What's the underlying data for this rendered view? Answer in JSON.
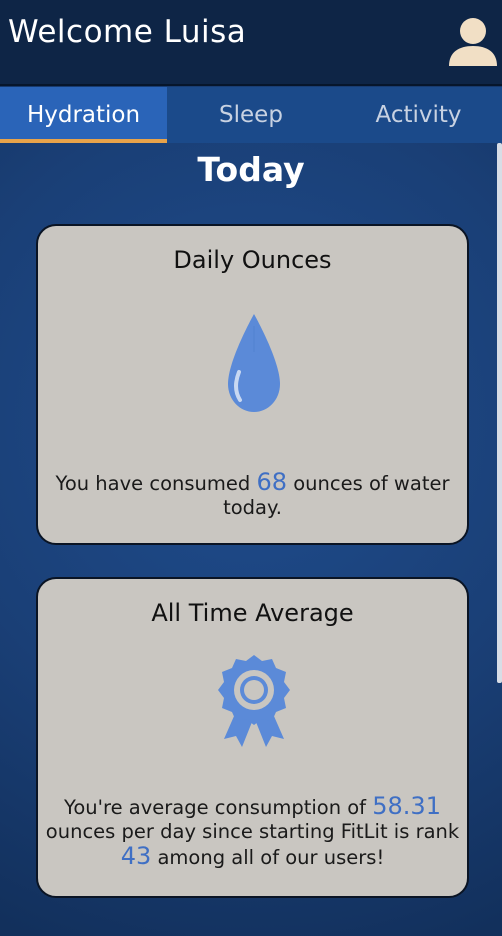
{
  "header": {
    "welcome": "Welcome Luisa"
  },
  "tabs": [
    {
      "label": "Hydration",
      "active": true
    },
    {
      "label": "Sleep",
      "active": false
    },
    {
      "label": "Activity",
      "active": false
    }
  ],
  "section_title": "Today",
  "daily_card": {
    "title": "Daily Ounces",
    "text_before": "You have consumed",
    "ounces": "68",
    "text_after": "ounces of water today.",
    "icon": "water-drop-icon"
  },
  "average_card": {
    "title": "All Time Average",
    "text_before": "You're average consumption of",
    "average": "58.31",
    "text_middle": "ounces per day since starting FitLit is rank",
    "rank": "43",
    "text_after": "among all of our users!",
    "icon": "award-ribbon-icon"
  },
  "colors": {
    "header_bg": "#0e2546",
    "tab_active": "#2a64b8",
    "tab_underline": "#e8a34a",
    "card_bg": "#c9c6c1",
    "accent_number": "#3f6fc4",
    "icon_blue": "#5b8ad8"
  }
}
